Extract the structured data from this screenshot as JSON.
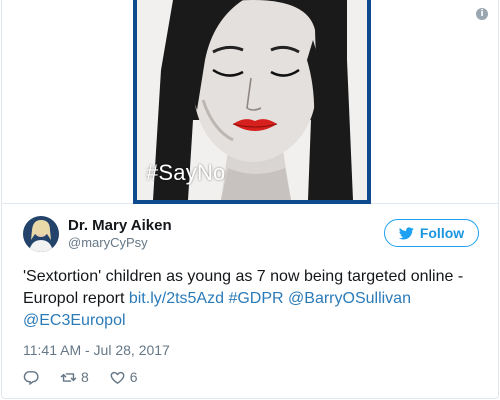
{
  "media": {
    "hashtag": "#SayNo",
    "background_color": "#0e4a8e"
  },
  "author": {
    "name": "Dr. Mary Aiken",
    "handle": "@maryCyPsy"
  },
  "follow_button": {
    "label": "Follow",
    "color": "#1b95e0"
  },
  "tweet": {
    "text_plain": "'Sextortion' children as young as 7 now being targeted online - Europol report",
    "links": [
      "bit.ly/2ts5Azd",
      "#GDPR",
      "@BarryOSullivan",
      "@EC3Europol"
    ],
    "link_color": "#2b7bb9"
  },
  "timestamp": "11:41 AM - Jul 28, 2017",
  "actions": {
    "reply_icon": "reply-icon",
    "retweet_count": "8",
    "like_count": "6"
  },
  "info_icon_glyph": "i"
}
